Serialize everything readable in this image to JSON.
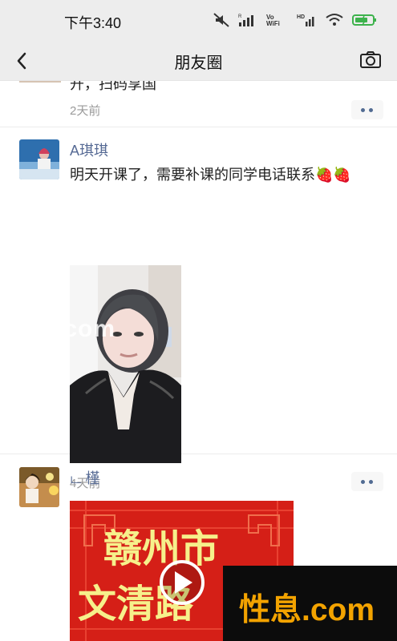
{
  "status": {
    "time": "下午3:40"
  },
  "nav": {
    "title": "朋友圈"
  },
  "feed": {
    "partial_post": {
      "text": "开，扫码享国",
      "time": "2天前"
    },
    "posts": [
      {
        "username": "A琪琪",
        "text": "明天开课了，需要补课的同学电话联系🍓🍓",
        "time": "4天前"
      },
      {
        "username": "ட 槿",
        "video_text_1": "赣州市",
        "video_text_2": "文清路"
      }
    ]
  },
  "watermarks": {
    "bottom_right": "性息.com",
    "left_center": "性息.com"
  },
  "colors": {
    "link_blue": "#576b95",
    "muted_gray": "#9a9a9a",
    "top_bar": "#ededed",
    "video_red": "#d51f17",
    "watermark_orange": "#f3a300"
  }
}
